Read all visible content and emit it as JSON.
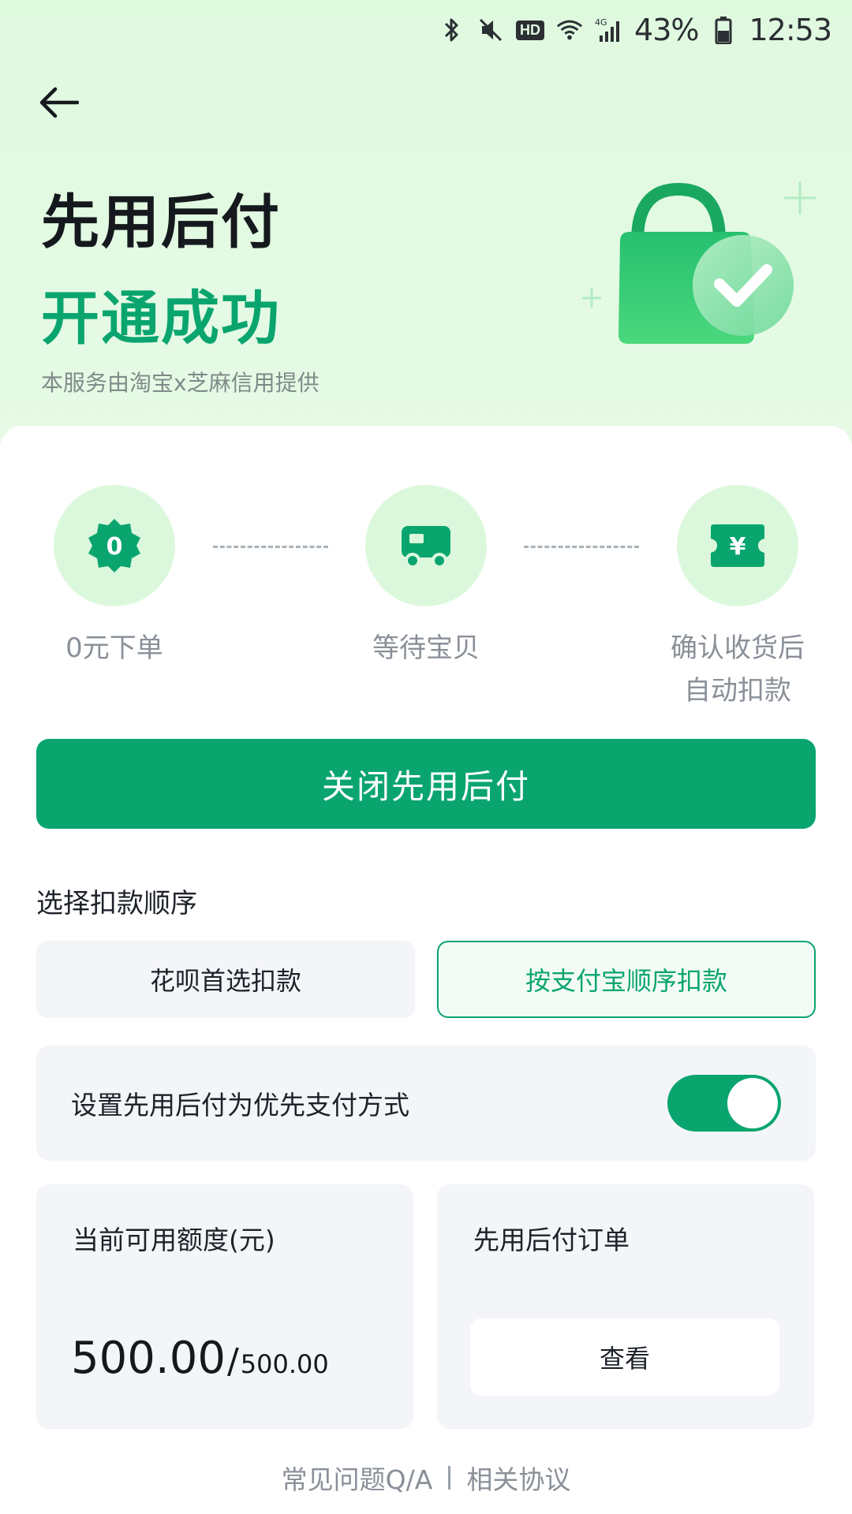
{
  "status_bar": {
    "battery": "43%",
    "time": "12:53",
    "network_badge": "HD",
    "icons": [
      "bluetooth-icon",
      "mute-icon",
      "hd-icon",
      "wifi-icon",
      "signal-4g-icon",
      "battery-icon"
    ]
  },
  "header": {
    "title_line1": "先用后付",
    "title_line2": "开通成功",
    "provider": "本服务由淘宝x芝麻信用提供"
  },
  "steps": [
    {
      "label": "0元下单",
      "icon": "zero-badge-icon"
    },
    {
      "label": "等待宝贝",
      "icon": "truck-icon"
    },
    {
      "label_line1": "确认收货后",
      "label_line2": "自动扣款",
      "icon": "yuan-ticket-icon"
    }
  ],
  "primary_action": {
    "label": "关闭先用后付"
  },
  "deduction_order": {
    "title": "选择扣款顺序",
    "options": [
      "花呗首选扣款",
      "按支付宝顺序扣款"
    ],
    "selected": "按支付宝顺序扣款"
  },
  "preference": {
    "label": "设置先用后付为优先支付方式",
    "enabled": true
  },
  "credit": {
    "title": "当前可用额度(元)",
    "available": "500.00",
    "separator": "/",
    "total": "500.00"
  },
  "orders": {
    "title": "先用后付订单",
    "button": "查看"
  },
  "footer": {
    "faq": "常见问题Q/A",
    "agreement": "相关协议"
  },
  "colors": {
    "accent": "#0aa56f",
    "header_bg": "#dff9df",
    "step_bg": "#dcf8dc"
  }
}
